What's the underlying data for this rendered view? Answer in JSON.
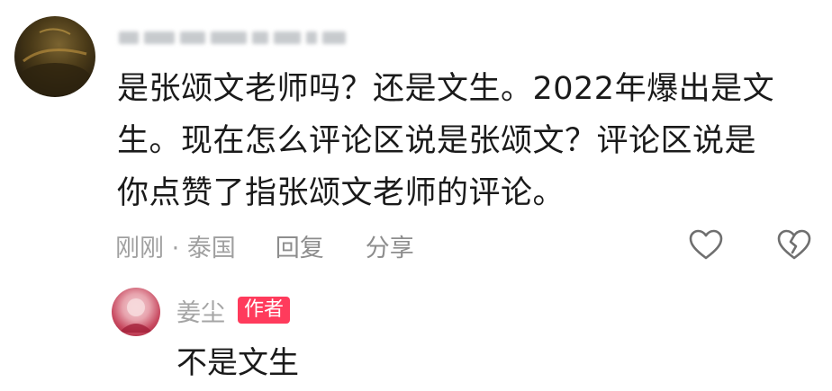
{
  "comment": {
    "text": "是张颂文老师吗？还是文生。2022年爆出是文生。现在怎么评论区说是张颂文？评论区说是你点赞了指张颂文老师的评论。",
    "time_location": "刚刚 · 泰国",
    "reply_label": "回复",
    "share_label": "分享"
  },
  "reply": {
    "username": "姜尘",
    "badge": "作者",
    "text": "不是文生"
  },
  "icons": {
    "like": "heart-outline-icon",
    "dislike": "broken-heart-icon"
  },
  "colors": {
    "badge": "#ff3b5c",
    "meta_text": "#9b9b9b",
    "main_text": "#1a1a1a"
  }
}
